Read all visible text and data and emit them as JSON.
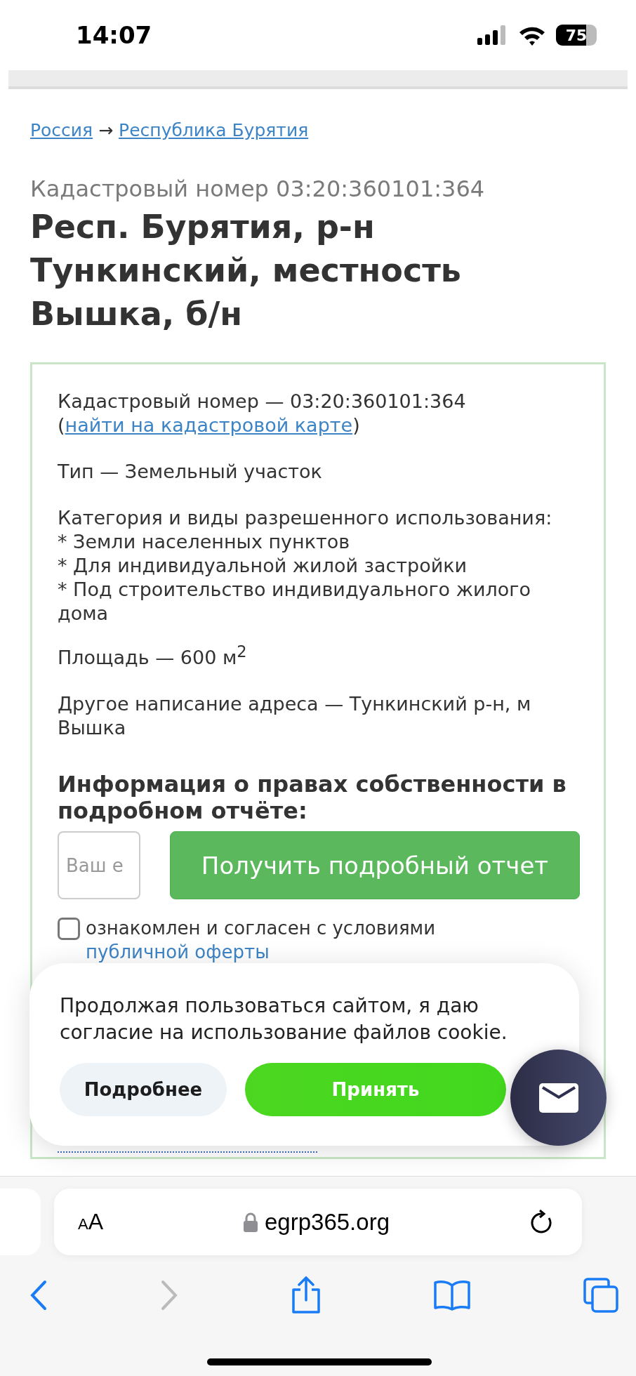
{
  "status_bar": {
    "time": "14:07",
    "battery": "75"
  },
  "breadcrumb": {
    "items": [
      {
        "label": "Россия"
      },
      {
        "label": "Республика Бурятия"
      }
    ],
    "separator": "→"
  },
  "subtitle": "Кадастровый номер 03:20:360101:364",
  "title": "Респ. Бурятия, р-н Тункинский, местность Вышка, б/н",
  "details": {
    "cadastral_text": "Кадастровый номер — 03:20:360101:364 (",
    "cadastral_link": "найти на кадастровой карте",
    "cadastral_after": ")",
    "type": "Тип — Земельный участок",
    "category_label": "Категория и виды разрешенного использования:",
    "category_items": [
      "* Земли населенных пунктов",
      "* Для индивидуальной жилой застройки",
      "* Под строительство индивидуального жилого дома"
    ],
    "area": "Площадь — 600 м$^{2}$",
    "alt_address": "Другое написание адреса — Тункинский р-н, м Вышка"
  },
  "ownership": {
    "heading": "Информация о правах собственности в подробном отчёте:",
    "email_placeholder": "Ваш e",
    "submit": "Получить подробный отчет",
    "consent": {
      "checked": false,
      "text": "ознакомлен и согласен с условиями ",
      "link": "публичной оферты"
    }
  },
  "cookie_banner": {
    "text": "Продолжая пользоваться сайтом, я даю согласие на использование файлов cookie.",
    "more": "Подробнее",
    "accept": "Принять"
  },
  "browser": {
    "text_size": "AA",
    "url": "egrp365.org",
    "forward_enabled": false
  }
}
